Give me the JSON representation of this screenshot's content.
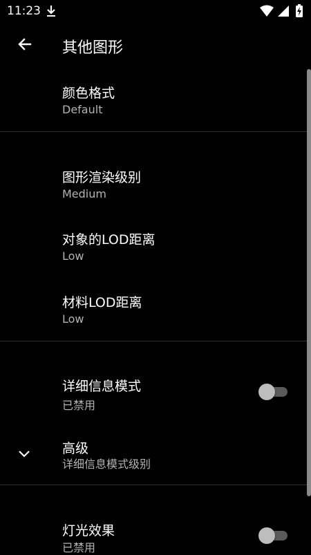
{
  "status_bar": {
    "time": "11:23"
  },
  "app_bar": {
    "title": "其他图形"
  },
  "items": [
    {
      "title": "颜色格式",
      "subtitle": "Default"
    },
    {
      "title": "图形渲染级别",
      "subtitle": "Medium"
    },
    {
      "title": "对象的LOD距离",
      "subtitle": "Low"
    },
    {
      "title": "材料LOD距离",
      "subtitle": "Low"
    },
    {
      "title": "详细信息模式",
      "subtitle": "已禁用",
      "toggle": false
    },
    {
      "title": "高级",
      "subtitle": "详细信息模式级别"
    },
    {
      "title": "灯光效果",
      "subtitle": "已禁用",
      "toggle": false
    }
  ]
}
